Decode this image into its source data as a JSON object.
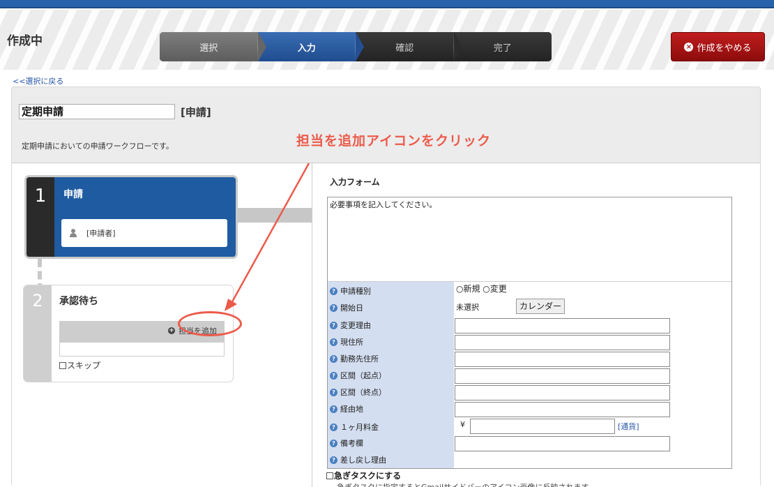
{
  "header": {
    "title": "作成中",
    "steps": [
      {
        "label": "選択"
      },
      {
        "label": "入力"
      },
      {
        "label": "確認"
      },
      {
        "label": "完了"
      }
    ],
    "cancel_label": "作成をやめる"
  },
  "back_link": "<<選択に戻る",
  "request": {
    "name": "定期申請",
    "suffix": "[申請]",
    "description": "定期申請においての申請ワークフローです。"
  },
  "annotation": "担当を追加アイコンをクリック",
  "workflow": {
    "step1": {
      "number": "1",
      "title": "申請",
      "person": "[申請者]"
    },
    "step2": {
      "number": "2",
      "title": "承認待ち",
      "add_label": "担当を追加",
      "skip_label": "スキップ"
    }
  },
  "form": {
    "title": "入力フォーム",
    "note": "必要事項を記入してください。",
    "fields": {
      "type": {
        "label": "申請種別",
        "options": "○新規 ○変更"
      },
      "start": {
        "label": "開始日",
        "value": "未選択",
        "button": "カレンダー"
      },
      "reason": {
        "label": "変更理由"
      },
      "address": {
        "label": "現住所"
      },
      "office": {
        "label": "勤務先住所"
      },
      "from": {
        "label": "区間（起点）"
      },
      "to": {
        "label": "区間（終点）"
      },
      "via": {
        "label": "経由地"
      },
      "fee": {
        "label": "１ヶ月料金",
        "yen": "¥",
        "currency": "[通貨]"
      },
      "remarks": {
        "label": "備考欄"
      },
      "return_reason": {
        "label": "差し戻し理由"
      }
    },
    "urgent_label": "急ぎタスクにする",
    "urgent_note": "急ぎタスクに指定するとGmailサイドバーのアイコン画像に反映されます"
  },
  "colors": {
    "accent_blue": "#1f5ba0",
    "cancel_red": "#a01212",
    "annotation_red": "#ec5a4a"
  }
}
